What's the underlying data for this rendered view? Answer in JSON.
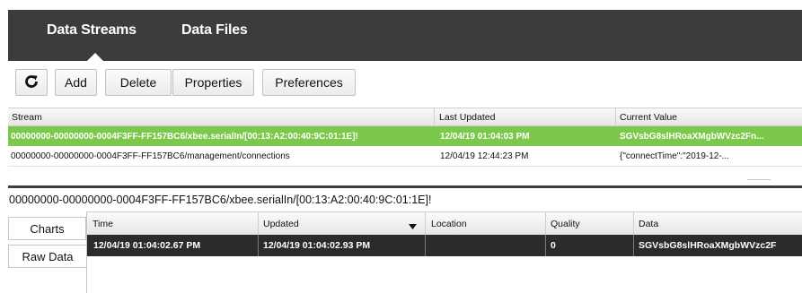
{
  "tabs": [
    {
      "label": "Data Streams",
      "active": true
    },
    {
      "label": "Data Files",
      "active": false
    }
  ],
  "toolbar": {
    "refresh_icon": "refresh-icon",
    "add_label": "Add",
    "delete_label": "Delete",
    "properties_label": "Properties",
    "preferences_label": "Preferences"
  },
  "streams_table": {
    "columns": [
      "Stream",
      "Last Updated",
      "Current Value"
    ],
    "rows": [
      {
        "stream": "00000000-00000000-0004F3FF-FF157BC6/xbee.serialIn/[00:13:A2:00:40:9C:01:1E]!",
        "last_updated": "12/04/19 01:04:03 PM",
        "current_value": "SGVsbG8slHRoaXMgbWVzc2Fn...",
        "selected": true
      },
      {
        "stream": "00000000-00000000-0004F3FF-FF157BC6/management/connections",
        "last_updated": "12/04/19 12:44:23 PM",
        "current_value": "{\"connectTime\":\"2019-12-...",
        "selected": false
      }
    ]
  },
  "detail": {
    "title": "00000000-00000000-0004F3FF-FF157BC6/xbee.serialIn/[00:13:A2:00:40:9C:01:1E]!",
    "side_tabs": [
      "Charts",
      "Raw Data"
    ],
    "columns": [
      "Time",
      "Updated",
      "Location",
      "Quality",
      "Data"
    ],
    "sort_icon": "sort-descending-icon",
    "rows": [
      {
        "time": "12/04/19 01:04:02.67 PM",
        "updated": "12/04/19 01:04:02.93 PM",
        "location": "",
        "quality": "0",
        "data": "SGVsbG8slHRoaXMgbWVzc2F"
      }
    ]
  },
  "colors": {
    "topbar": "#3c3c3c",
    "selected_row": "#7cc84a",
    "selected_detail_row": "#2b2b2b"
  }
}
